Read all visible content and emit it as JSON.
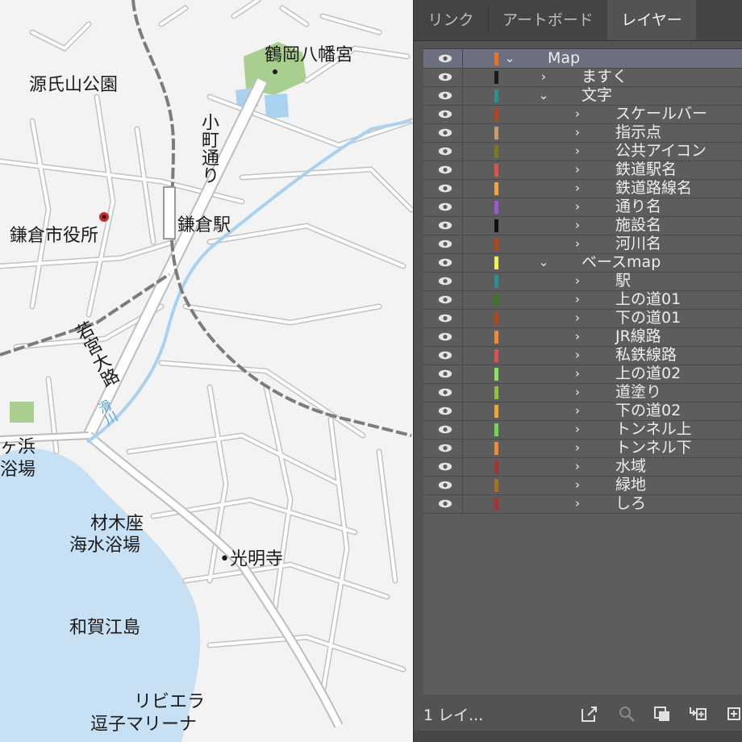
{
  "map": {
    "labels": {
      "tsurugaoka": "鶴岡八幡宮",
      "genjiyama": "源氏山公園",
      "komachi": "小町通り",
      "kamakura_station": "鎌倉駅",
      "city_hall": "鎌倉市役所",
      "wakamiya": "若宮大路",
      "namerigawa": "滑川",
      "yuigahama_1": "ヶ浜",
      "yuigahama_2": "浴場",
      "zaimokuza_1": "材木座",
      "zaimokuza_2": "海水浴場",
      "komyoji": "•光明寺",
      "wakaejima": "和賀江島",
      "riviera_1": "リビエラ",
      "riviera_2": "逗子マリーナ"
    },
    "colors": {
      "sea": "#c7e0f4",
      "river": "#a9d2f0",
      "park": "#a9cf8e",
      "road": "#ffffff",
      "road_edge": "#bdbdbd",
      "rail": "#808080"
    }
  },
  "panel": {
    "tabs": [
      "リンク",
      "アートボード",
      "レイヤー"
    ],
    "active_tab": "レイヤー",
    "layers": [
      {
        "name": "Map",
        "color": "#e8731a",
        "level": 0,
        "expanded": true,
        "selected": true
      },
      {
        "name": "ますく",
        "color": "#1a1a1a",
        "level": 1,
        "expanded": false
      },
      {
        "name": "文字",
        "color": "#2b8f95",
        "level": 1,
        "expanded": true
      },
      {
        "name": "スケールバー",
        "color": "#b5451b",
        "level": 2,
        "expanded": false
      },
      {
        "name": "指示点",
        "color": "#c99a6a",
        "level": 2,
        "expanded": false
      },
      {
        "name": "公共アイコン",
        "color": "#7a7a1e",
        "level": 2,
        "expanded": false
      },
      {
        "name": "鉄道駅名",
        "color": "#e0524f",
        "level": 2,
        "expanded": false
      },
      {
        "name": "鉄道路線名",
        "color": "#f2a437",
        "level": 2,
        "expanded": false
      },
      {
        "name": "通り名",
        "color": "#9e5ad6",
        "level": 2,
        "expanded": false
      },
      {
        "name": "施設名",
        "color": "#111111",
        "level": 2,
        "expanded": false
      },
      {
        "name": "河川名",
        "color": "#b5451b",
        "level": 2,
        "expanded": false
      },
      {
        "name": "ベースmap",
        "color": "#f2f05a",
        "level": 1,
        "expanded": true
      },
      {
        "name": "駅",
        "color": "#2b8f95",
        "level": 2,
        "expanded": false
      },
      {
        "name": "上の道01",
        "color": "#3b7a1e",
        "level": 2,
        "expanded": false
      },
      {
        "name": "下の道01",
        "color": "#b5451b",
        "level": 2,
        "expanded": false
      },
      {
        "name": "JR線路",
        "color": "#ef8a3a",
        "level": 2,
        "expanded": false
      },
      {
        "name": "私鉄線路",
        "color": "#e0524f",
        "level": 2,
        "expanded": false
      },
      {
        "name": "上の道02",
        "color": "#8be062",
        "level": 2,
        "expanded": false
      },
      {
        "name": "道塗り",
        "color": "#8fc23f",
        "level": 2,
        "expanded": false
      },
      {
        "name": "下の道02",
        "color": "#f2a437",
        "level": 2,
        "expanded": false
      },
      {
        "name": "トンネル上",
        "color": "#76d651",
        "level": 2,
        "expanded": false
      },
      {
        "name": "トンネル下",
        "color": "#ef8a3a",
        "level": 2,
        "expanded": false
      },
      {
        "name": "水域",
        "color": "#a83232",
        "level": 2,
        "expanded": false
      },
      {
        "name": "緑地",
        "color": "#a8701e",
        "level": 2,
        "expanded": false
      },
      {
        "name": "しろ",
        "color": "#a83232",
        "level": 2,
        "expanded": false
      }
    ],
    "footer": {
      "layer_count": "1 レイ...",
      "icons": [
        "export-icon",
        "search-icon",
        "clip-mask-icon",
        "new-sublayer-icon",
        "new-layer-icon"
      ]
    }
  }
}
